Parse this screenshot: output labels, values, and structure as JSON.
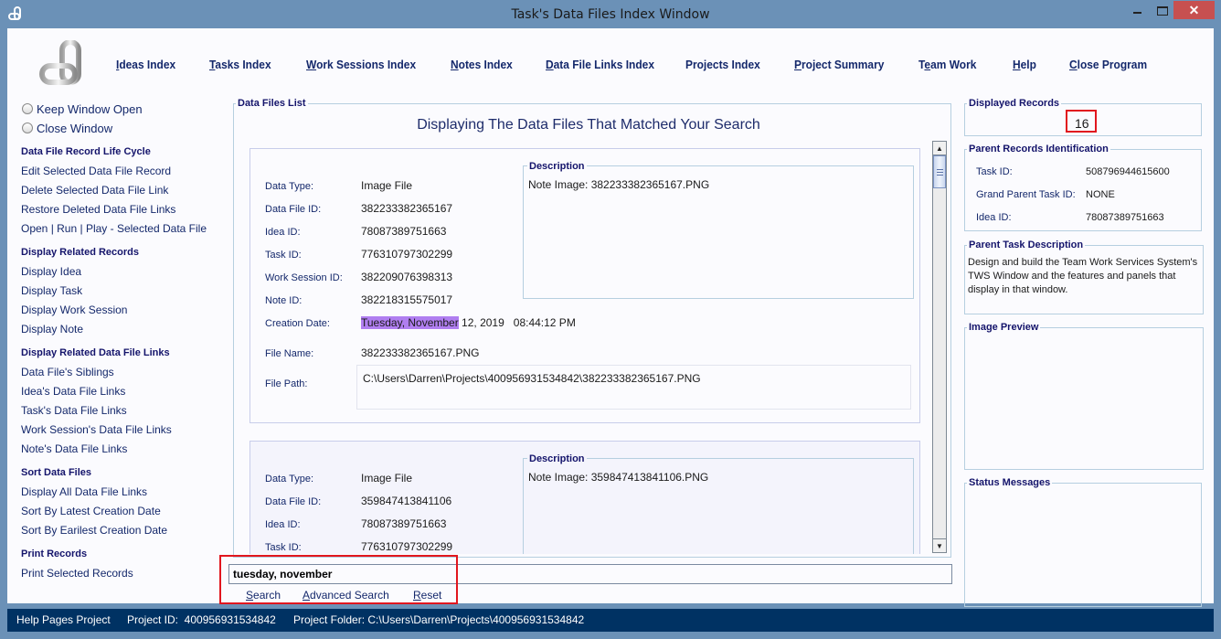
{
  "window": {
    "title": "Task's Data Files Index Window",
    "icon": "chain-link-icon"
  },
  "topnav": [
    {
      "label": "Ideas Index",
      "mnemonic": "I"
    },
    {
      "label": "Tasks Index",
      "mnemonic": "T"
    },
    {
      "label": "Work Sessions Index",
      "mnemonic": "W"
    },
    {
      "label": "Notes Index",
      "mnemonic": "N"
    },
    {
      "label": "Data File Links Index",
      "mnemonic": "D"
    },
    {
      "label": "Projects Index",
      "mnemonic": ""
    },
    {
      "label": "Project Summary",
      "mnemonic": "P"
    },
    {
      "label": "Team Work",
      "mnemonic": "e"
    },
    {
      "label": "Help",
      "mnemonic": "H"
    },
    {
      "label": "Close Program",
      "mnemonic": "C"
    }
  ],
  "sidebar": {
    "radios": [
      {
        "label": "Keep Window Open",
        "checked": false
      },
      {
        "label": "Close Window",
        "checked": false
      }
    ],
    "sections": [
      {
        "heading": "Data File Record Life Cycle",
        "items": [
          "Edit Selected Data File Record",
          "Delete Selected Data File Link",
          "Restore Deleted Data File Links",
          "Open | Run | Play - Selected Data File"
        ]
      },
      {
        "heading": "Display Related Records",
        "items": [
          "Display Idea",
          "Display Task",
          "Display Work Session",
          "Display Note"
        ]
      },
      {
        "heading": "Display Related Data File Links",
        "items": [
          "Data File's Siblings",
          "Idea's Data File Links",
          "Task's Data File Links",
          "Work Session's Data File Links",
          "Note's Data File Links"
        ]
      },
      {
        "heading": "Sort Data Files",
        "items": [
          "Display All Data File Links",
          "Sort By Latest Creation Date",
          "Sort By Earilest Creation Date"
        ]
      },
      {
        "heading": "Print Records",
        "items": [
          "Print Selected Records"
        ]
      }
    ]
  },
  "data_files_list": {
    "legend": "Data Files List",
    "heading": "Displaying The Data Files That Matched Your Search",
    "labels": {
      "data_type": "Data Type:",
      "data_file_id": "Data File ID:",
      "idea_id": "Idea ID:",
      "task_id": "Task ID:",
      "work_session_id": "Work Session ID:",
      "note_id": "Note ID:",
      "creation_date": "Creation Date:",
      "file_name": "File Name:",
      "file_path": "File Path:",
      "description": "Description"
    },
    "records": [
      {
        "data_type": "Image File",
        "data_file_id": "382233382365167",
        "idea_id": "78087389751663",
        "task_id": "776310797302299",
        "work_session_id": "382209076398313",
        "note_id": "382218315575017",
        "creation_date_highlight": "Tuesday, November",
        "creation_date_rest": " 12, 2019   08:44:12 PM",
        "file_name": "382233382365167.PNG",
        "file_path": "C:\\Users\\Darren\\Projects\\400956931534842\\382233382365167.PNG",
        "description": "Note Image: 382233382365167.PNG"
      },
      {
        "data_type": "Image File",
        "data_file_id": "359847413841106",
        "idea_id": "78087389751663",
        "task_id": "776310797302299",
        "description": "Note Image: 359847413841106.PNG"
      }
    ],
    "highlight_color": "#b07ef0"
  },
  "search": {
    "value": "tuesday, november",
    "actions": [
      {
        "label": "Search",
        "mnemonic": "S"
      },
      {
        "label": "Advanced Search",
        "mnemonic": "A"
      },
      {
        "label": "Reset",
        "mnemonic": "R"
      }
    ]
  },
  "right_panel": {
    "displayed_records": {
      "legend": "Displayed Records",
      "value": "16"
    },
    "parent_records": {
      "legend": "Parent Records Identification",
      "rows": [
        {
          "label": "Task ID:",
          "value": "508796944615600"
        },
        {
          "label": "Grand Parent Task ID:",
          "value": "NONE"
        },
        {
          "label": "Idea ID:",
          "value": "78087389751663"
        }
      ]
    },
    "parent_task_description": {
      "legend": "Parent Task Description",
      "text": "Design and build the Team Work Services System's TWS Window and the features and panels that display in that window."
    },
    "image_preview": {
      "legend": "Image Preview"
    },
    "status_messages": {
      "legend": "Status Messages"
    }
  },
  "statusbar": {
    "project": "Help Pages Project",
    "project_id": "Project ID:  400956931534842",
    "project_folder": "Project Folder: C:\\Users\\Darren\\Projects\\400956931534842"
  },
  "colors": {
    "titlebar": "#6b91b7",
    "statusbar": "#003263",
    "close_button": "#c75050",
    "annotation_box": "#e1161e",
    "link_text": "#14286b"
  }
}
